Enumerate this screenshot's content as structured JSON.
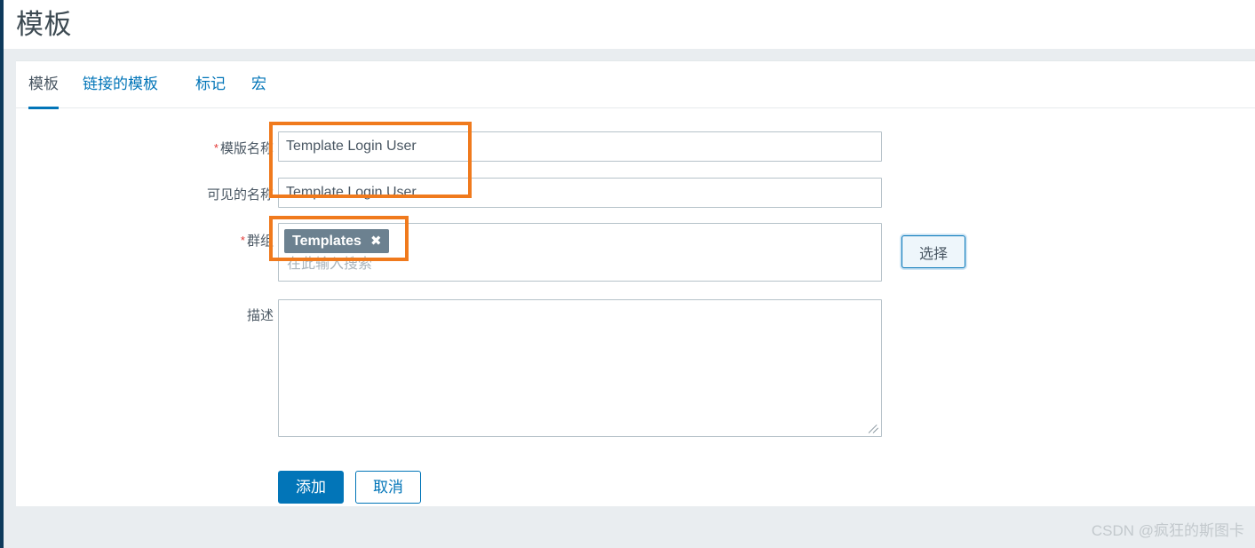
{
  "page": {
    "title": "模板",
    "watermark": "CSDN @疯狂的斯图卡"
  },
  "colors": {
    "accent": "#0275b8",
    "annotation": "#f07a1d",
    "required": "#e33734",
    "chip_bg": "#6c8190",
    "page_bg": "#e9edf0",
    "rail": "#0e3a5c"
  },
  "tabs": [
    {
      "label": "模板",
      "active": true
    },
    {
      "label": "链接的模板",
      "active": false
    },
    {
      "label": "标记",
      "active": false
    },
    {
      "label": "宏",
      "active": false
    }
  ],
  "form": {
    "template_name": {
      "label": "模版名称",
      "required_marker": "*",
      "value": "Template Login User",
      "placeholder": ""
    },
    "visible_name": {
      "label": "可见的名称",
      "required_marker": "",
      "value": "Template Login User",
      "placeholder": ""
    },
    "groups": {
      "label": "群组",
      "required_marker": "*",
      "chips": [
        {
          "label": "Templates",
          "remove_icon": "✖"
        }
      ],
      "placeholder": "在此输入搜索",
      "select_button": "选择"
    },
    "description": {
      "label": "描述",
      "required_marker": "",
      "value": "",
      "placeholder": ""
    }
  },
  "actions": {
    "submit": "添加",
    "cancel": "取消"
  }
}
